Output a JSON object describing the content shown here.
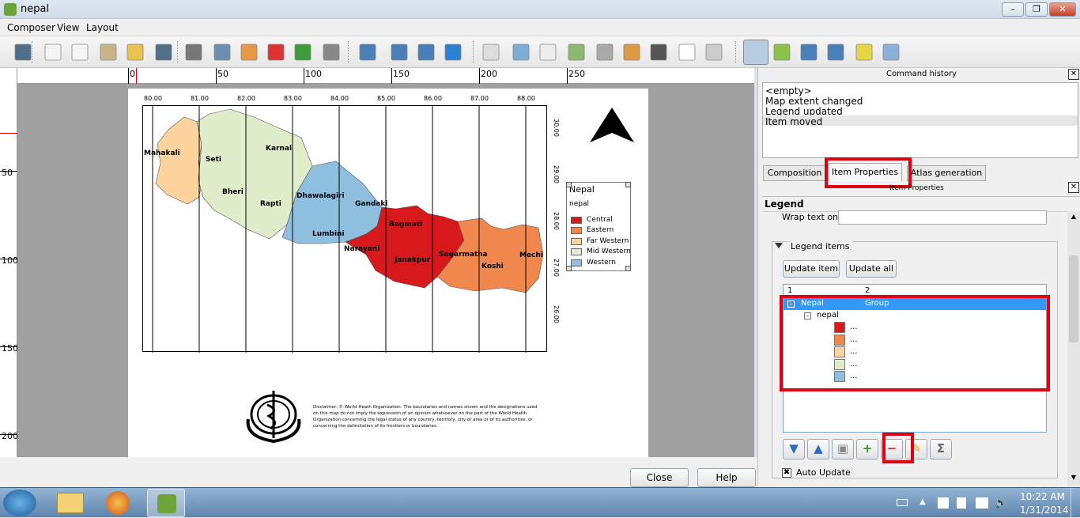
{
  "window": {
    "title": "nepal"
  },
  "menu": [
    "Composer",
    "View",
    "Layout"
  ],
  "toolbar_icons": [
    "save-icon",
    "new-composer-icon",
    "duplicate-composer-icon",
    "composer-manager-icon",
    "load-template-icon",
    "save-template-icon",
    "print-icon",
    "export-image-icon",
    "export-svg-icon",
    "export-pdf-icon",
    "undo-icon",
    "redo-icon",
    "zoom-full-icon",
    "zoom-in-icon",
    "zoom-out-icon",
    "refresh-icon",
    "add-map-icon",
    "add-image-icon",
    "add-label-icon",
    "add-legend-icon",
    "add-scalebar-icon",
    "add-shape-icon",
    "add-arrow-icon",
    "add-table-icon",
    "add-html-icon",
    "select-icon",
    "move-content-icon",
    "group-icon",
    "ungroup-icon",
    "raise-icon",
    "align-icon"
  ],
  "ruler": {
    "top": [
      "0",
      "50",
      "100",
      "150",
      "200",
      "250"
    ],
    "left": [
      "50",
      "100",
      "150",
      "200"
    ]
  },
  "map": {
    "lon_labels": [
      "80.00",
      "81.00",
      "82.00",
      "83.00",
      "84.00",
      "85.00",
      "86.00",
      "87.00",
      "88.00"
    ],
    "lat_labels": [
      "30.00",
      "29.00",
      "28.00",
      "27.00",
      "26.00"
    ],
    "regions": [
      "Mahakali",
      "Seti",
      "Karnal",
      "Bheri",
      "Rapti",
      "Dhawalagiri",
      "Gandaki",
      "Bagmati",
      "Lumbini",
      "Narayani",
      "Janakpur",
      "Sagarmatha",
      "Koshi",
      "Mechi"
    ],
    "legend": {
      "title": "Nepal",
      "layer": "nepal",
      "items": [
        {
          "label": "Central",
          "color": "#d7191c"
        },
        {
          "label": "Eastern",
          "color": "#f0884e"
        },
        {
          "label": "Far Western",
          "color": "#fdd49e"
        },
        {
          "label": "Mid Western",
          "color": "#e0edcb"
        },
        {
          "label": "Western",
          "color": "#8fbfde"
        }
      ]
    },
    "disclaimer": "Disclaimer: © World Heath Organization. The boundaries and names shown and the designations used on this map do not imply the expression of an opinion whatsoever on the part of the World Health Organization concerning the legal status of any country, territory, city or area or of its authorities, or concerning the delimitation of its frontiers or boundaries."
  },
  "buttons": {
    "close": "Close",
    "help": "Help"
  },
  "history": {
    "title": "Command history",
    "items": [
      "<empty>",
      "Map extent changed",
      "Legend updated",
      "Item moved"
    ]
  },
  "tabs": [
    "Composition",
    "Item Properties",
    "Atlas generation"
  ],
  "props": {
    "subtitle": "Item Properties",
    "section": "Legend",
    "wrap_label": "Wrap text on",
    "wrap_value": "",
    "items_group": "Legend items",
    "update_item": "Update item",
    "update_all": "Update all",
    "tree_cols": [
      "1",
      "2"
    ],
    "tree_root": "Nepal",
    "tree_root_type": "Group",
    "tree_layer": "nepal",
    "tree_items": [
      "...",
      "...",
      "...",
      "...",
      "..."
    ],
    "auto_update": "Auto Update"
  },
  "tray": {
    "time": "10:22 AM",
    "date": "1/31/2014"
  }
}
